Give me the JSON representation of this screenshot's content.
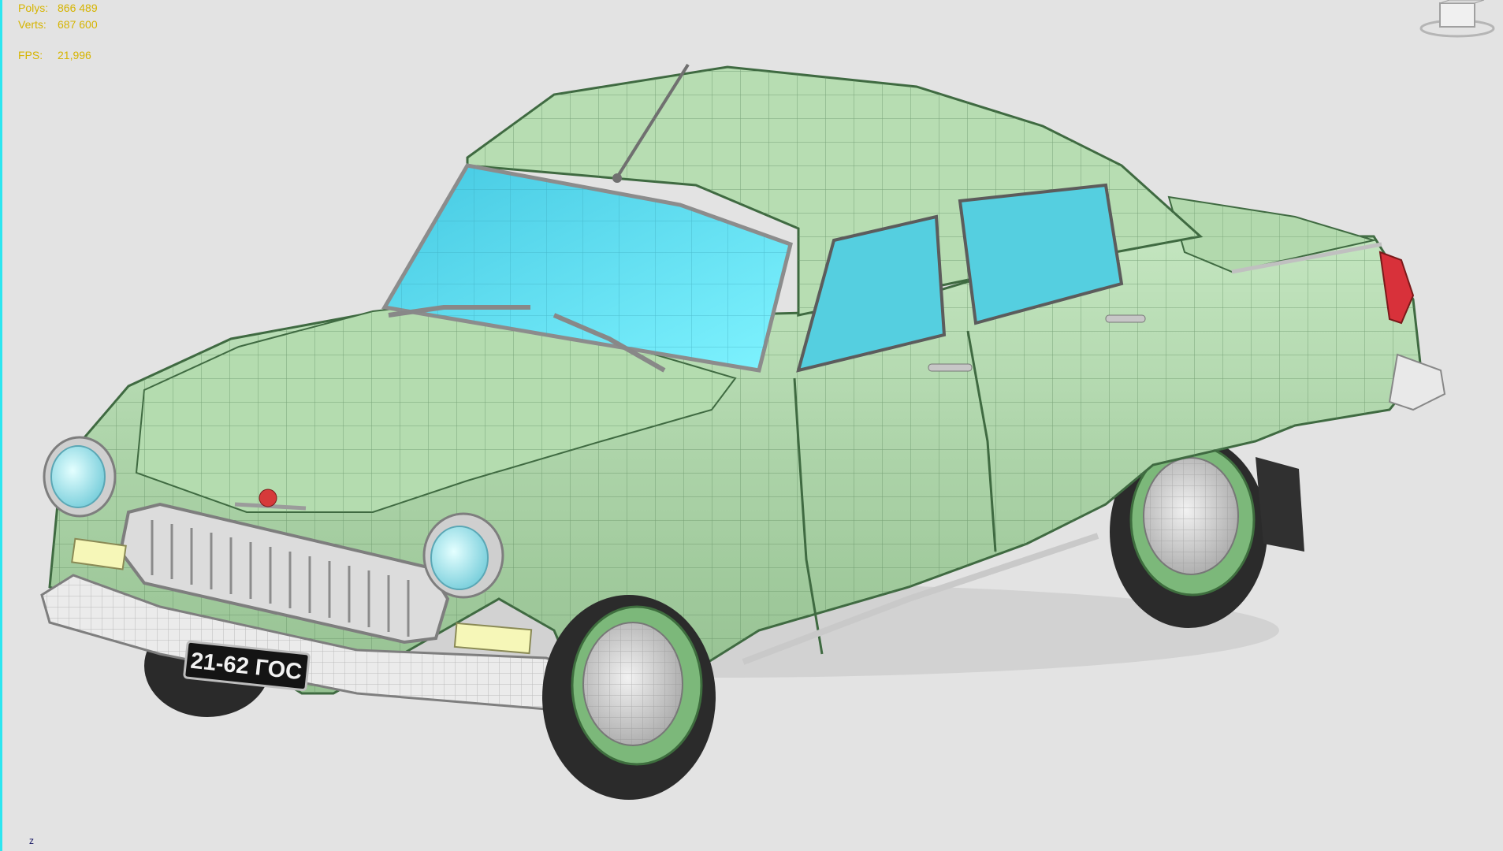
{
  "stats": {
    "polys_label": "Polys:",
    "polys_value": "866 489",
    "verts_label": "Verts:",
    "verts_value": "687 600",
    "fps_label": "FPS:",
    "fps_value": "21,996"
  },
  "viewcube": {
    "icon": "viewcube-icon"
  },
  "axis": {
    "label": "z"
  },
  "plate": {
    "text": "21-62 ГОС"
  },
  "colors": {
    "body": "#a8d4a4",
    "glass": "#5fd8ec",
    "wireframe": "#4f7a52",
    "viewport_bg": "#e3e3e3",
    "stats_text": "#d6b400"
  }
}
